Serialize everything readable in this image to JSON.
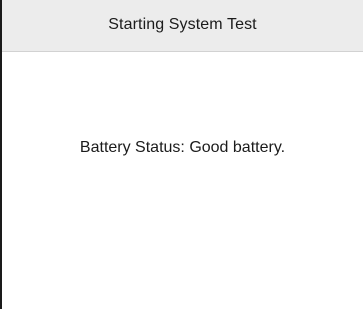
{
  "window": {
    "title": "Starting System Test"
  },
  "status": {
    "label": "Battery Status:",
    "value": "Good battery."
  },
  "colors": {
    "title_bar_background": "#ececec",
    "content_background": "#ffffff",
    "text": "#1b1b1b"
  }
}
